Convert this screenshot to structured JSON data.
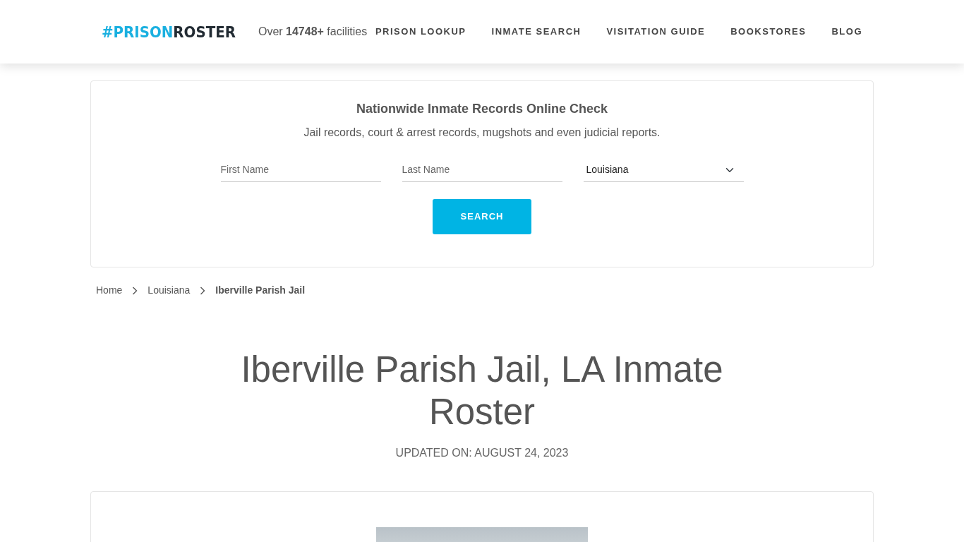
{
  "header": {
    "logo": [
      "#PRISON",
      "ROSTER"
    ],
    "tagline": "Over **14748+** facilities",
    "nav": [
      {
        "label": "PRISON LOOKUP"
      },
      {
        "label": "INMATE SEARCH"
      },
      {
        "label": "VISITATION GUIDE"
      },
      {
        "label": "BOOKSTORES"
      },
      {
        "label": "BLOG"
      }
    ]
  },
  "search_card": {
    "title": "Nationwide Inmate Records Online Check",
    "subtitle": "Jail records, court & arrest records, mugshots and even judicial reports.",
    "fields": [
      {
        "kind": "input",
        "placeholder": "First Name"
      },
      {
        "kind": "input",
        "placeholder": "Last Name"
      },
      {
        "kind": "select",
        "value": "Louisiana"
      }
    ],
    "button": "SEARCH"
  },
  "breadcrumb": [
    {
      "label": "Home",
      "current": false
    },
    {
      "label": "Louisiana",
      "current": false
    },
    {
      "label": "Iberville Parish Jail",
      "current": true
    }
  ],
  "title": "Iberville Parish Jail, LA Inmate Roster",
  "updated": "UPDATED ON: AUGUST 24, 2023"
}
